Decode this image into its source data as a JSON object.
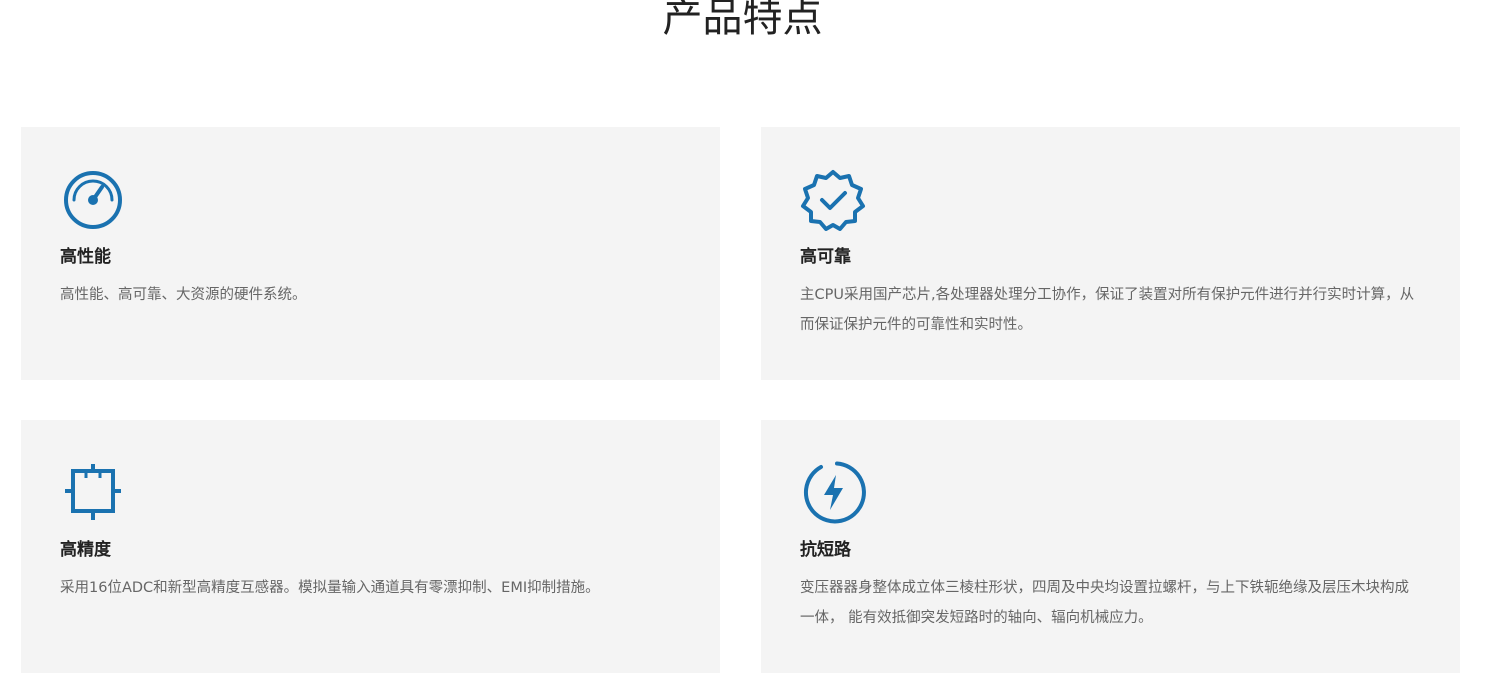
{
  "section": {
    "title": "产品特点"
  },
  "colors": {
    "accent": "#1a72b0",
    "card_bg": "#f4f4f4",
    "title_text": "#222222",
    "body_text": "#666666"
  },
  "features": [
    {
      "icon": "speedometer-icon",
      "title": "高性能",
      "description": "高性能、高可靠、大资源的硬件系统。"
    },
    {
      "icon": "verified-badge-icon",
      "title": "高可靠",
      "description": "主CPU采用国产芯片,各处理器处理分工协作，保证了装置对所有保护元件进行并行实时计算，从而保证保护元件的可靠性和实时性。"
    },
    {
      "icon": "crosshair-frame-icon",
      "title": "高精度",
      "description": "采用16位ADC和新型高精度互感器。模拟量输入通道具有零漂抑制、EMI抑制措施。"
    },
    {
      "icon": "lightning-circle-icon",
      "title": "抗短路",
      "description": "变压器器身整体成立体三棱柱形状，四周及中央均设置拉螺杆，与上下铁轭绝缘及层压木块构成一体， 能有效抵御突发短路时的轴向、辐向机械应力。"
    }
  ]
}
